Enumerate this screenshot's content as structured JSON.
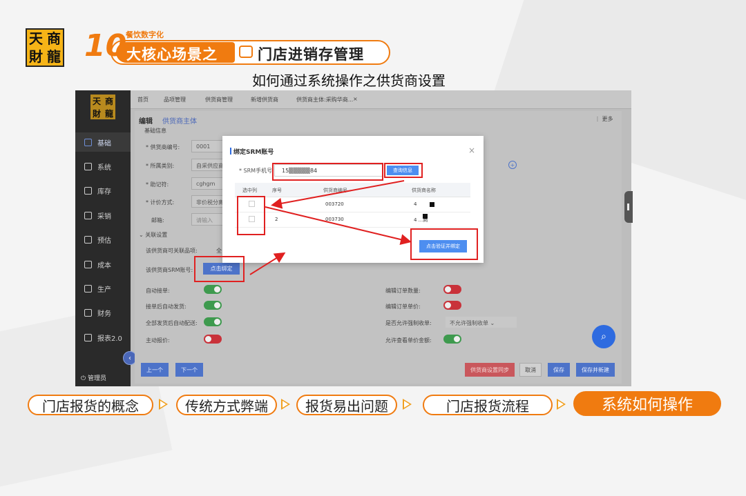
{
  "logo": {
    "chars": [
      "天",
      "商",
      "財",
      "龍"
    ]
  },
  "banner": {
    "number": "10",
    "subtitle": "餐饮数字化",
    "left_text": "大核心场景之",
    "right_text": "门店进销存管理",
    "icon": "cash-register-icon"
  },
  "slide_title": "如何通过系统操作之供货商设置",
  "screenshot": {
    "sidebar": {
      "logo_chars": [
        "天",
        "商",
        "財",
        "龍"
      ],
      "items": [
        {
          "label": "基础",
          "icon": "base-icon",
          "active": true
        },
        {
          "label": "系统",
          "icon": "system-icon"
        },
        {
          "label": "库存",
          "icon": "inventory-icon"
        },
        {
          "label": "采销",
          "icon": "purchase-icon"
        },
        {
          "label": "预估",
          "icon": "forecast-icon"
        },
        {
          "label": "成本",
          "icon": "cost-icon"
        },
        {
          "label": "生产",
          "icon": "production-icon"
        },
        {
          "label": "财务",
          "icon": "finance-icon"
        },
        {
          "label": "报表2.0",
          "icon": "report-icon"
        }
      ],
      "user": "管理员"
    },
    "tabs": [
      "首页",
      "品项管理",
      "供货商管理",
      "新增供货商",
      "供货商主体:采购华商..."
    ],
    "tab_close": "×",
    "breadcrumb": {
      "edit": "编辑",
      "entity": "供货商主体"
    },
    "more": "更多",
    "form": {
      "basic_section": "基础信息",
      "supplier_code_label": "* 供货商编号:",
      "supplier_code_value": "0001",
      "category_label": "* 所属类别:",
      "category_value": "自采供应商",
      "mnemonic_label": "* 助记符:",
      "mnemonic_value": "cghgm",
      "pricing_label": "* 计价方式:",
      "pricing_value": "非价税分离",
      "email_label": "邮箱:",
      "email_placeholder": "请输入",
      "related_section": "关联设置",
      "link_items_label": "该供货商可关联品项:",
      "link_items_value": "全",
      "srm_label": "该供货商SRM账号:",
      "bind_button": "点击绑定",
      "auto_accept_label": "自动接单:",
      "auto_ship_label": "接单后自动发货:",
      "auto_deliver_label": "全部发货后自动配送:",
      "active_quote_label": "主动报价:",
      "edit_qty_label": "编辑订单数量:",
      "edit_price_label": "编辑订单单价:",
      "force_arrival_label": "是否允许强制收单:",
      "force_arrival_value": "不允许强制收单",
      "view_price_label": "允许查看单价金额:"
    },
    "toggles": {
      "auto_accept": true,
      "auto_ship": true,
      "auto_deliver": true,
      "active_quote": false,
      "edit_qty": false,
      "edit_price": false,
      "view_price": true
    },
    "footer": {
      "prev": "上一个",
      "next": "下一个",
      "supplier_settings": "供货商设置同步",
      "cancel": "取消",
      "save": "保存",
      "save_new": "保存并新建"
    },
    "modal": {
      "title": "绑定SRM账号",
      "close": "×",
      "phone_label": "* SRM手机号:",
      "phone_value": "15▒▒▒▒▒84",
      "query_button": "查询信息",
      "columns": [
        "选中列",
        "序号",
        "供货商编号",
        "供货商名称"
      ],
      "rows": [
        {
          "index": "1",
          "code": "003720",
          "name": "4"
        },
        {
          "index": "2",
          "code": "003730",
          "name": "4 ...商"
        }
      ],
      "confirm_button": "点击验证并绑定"
    }
  },
  "bottom_nav": [
    {
      "label": "门店报货的概念"
    },
    {
      "label": "传统方式弊端"
    },
    {
      "label": "报货易出问题"
    },
    {
      "label": "门店报货流程"
    },
    {
      "label": "系统如何操作",
      "active": true
    }
  ],
  "colors": {
    "accent": "#f07b10",
    "highlight": "#e02020",
    "primary_blue": "#4d8ef0"
  }
}
